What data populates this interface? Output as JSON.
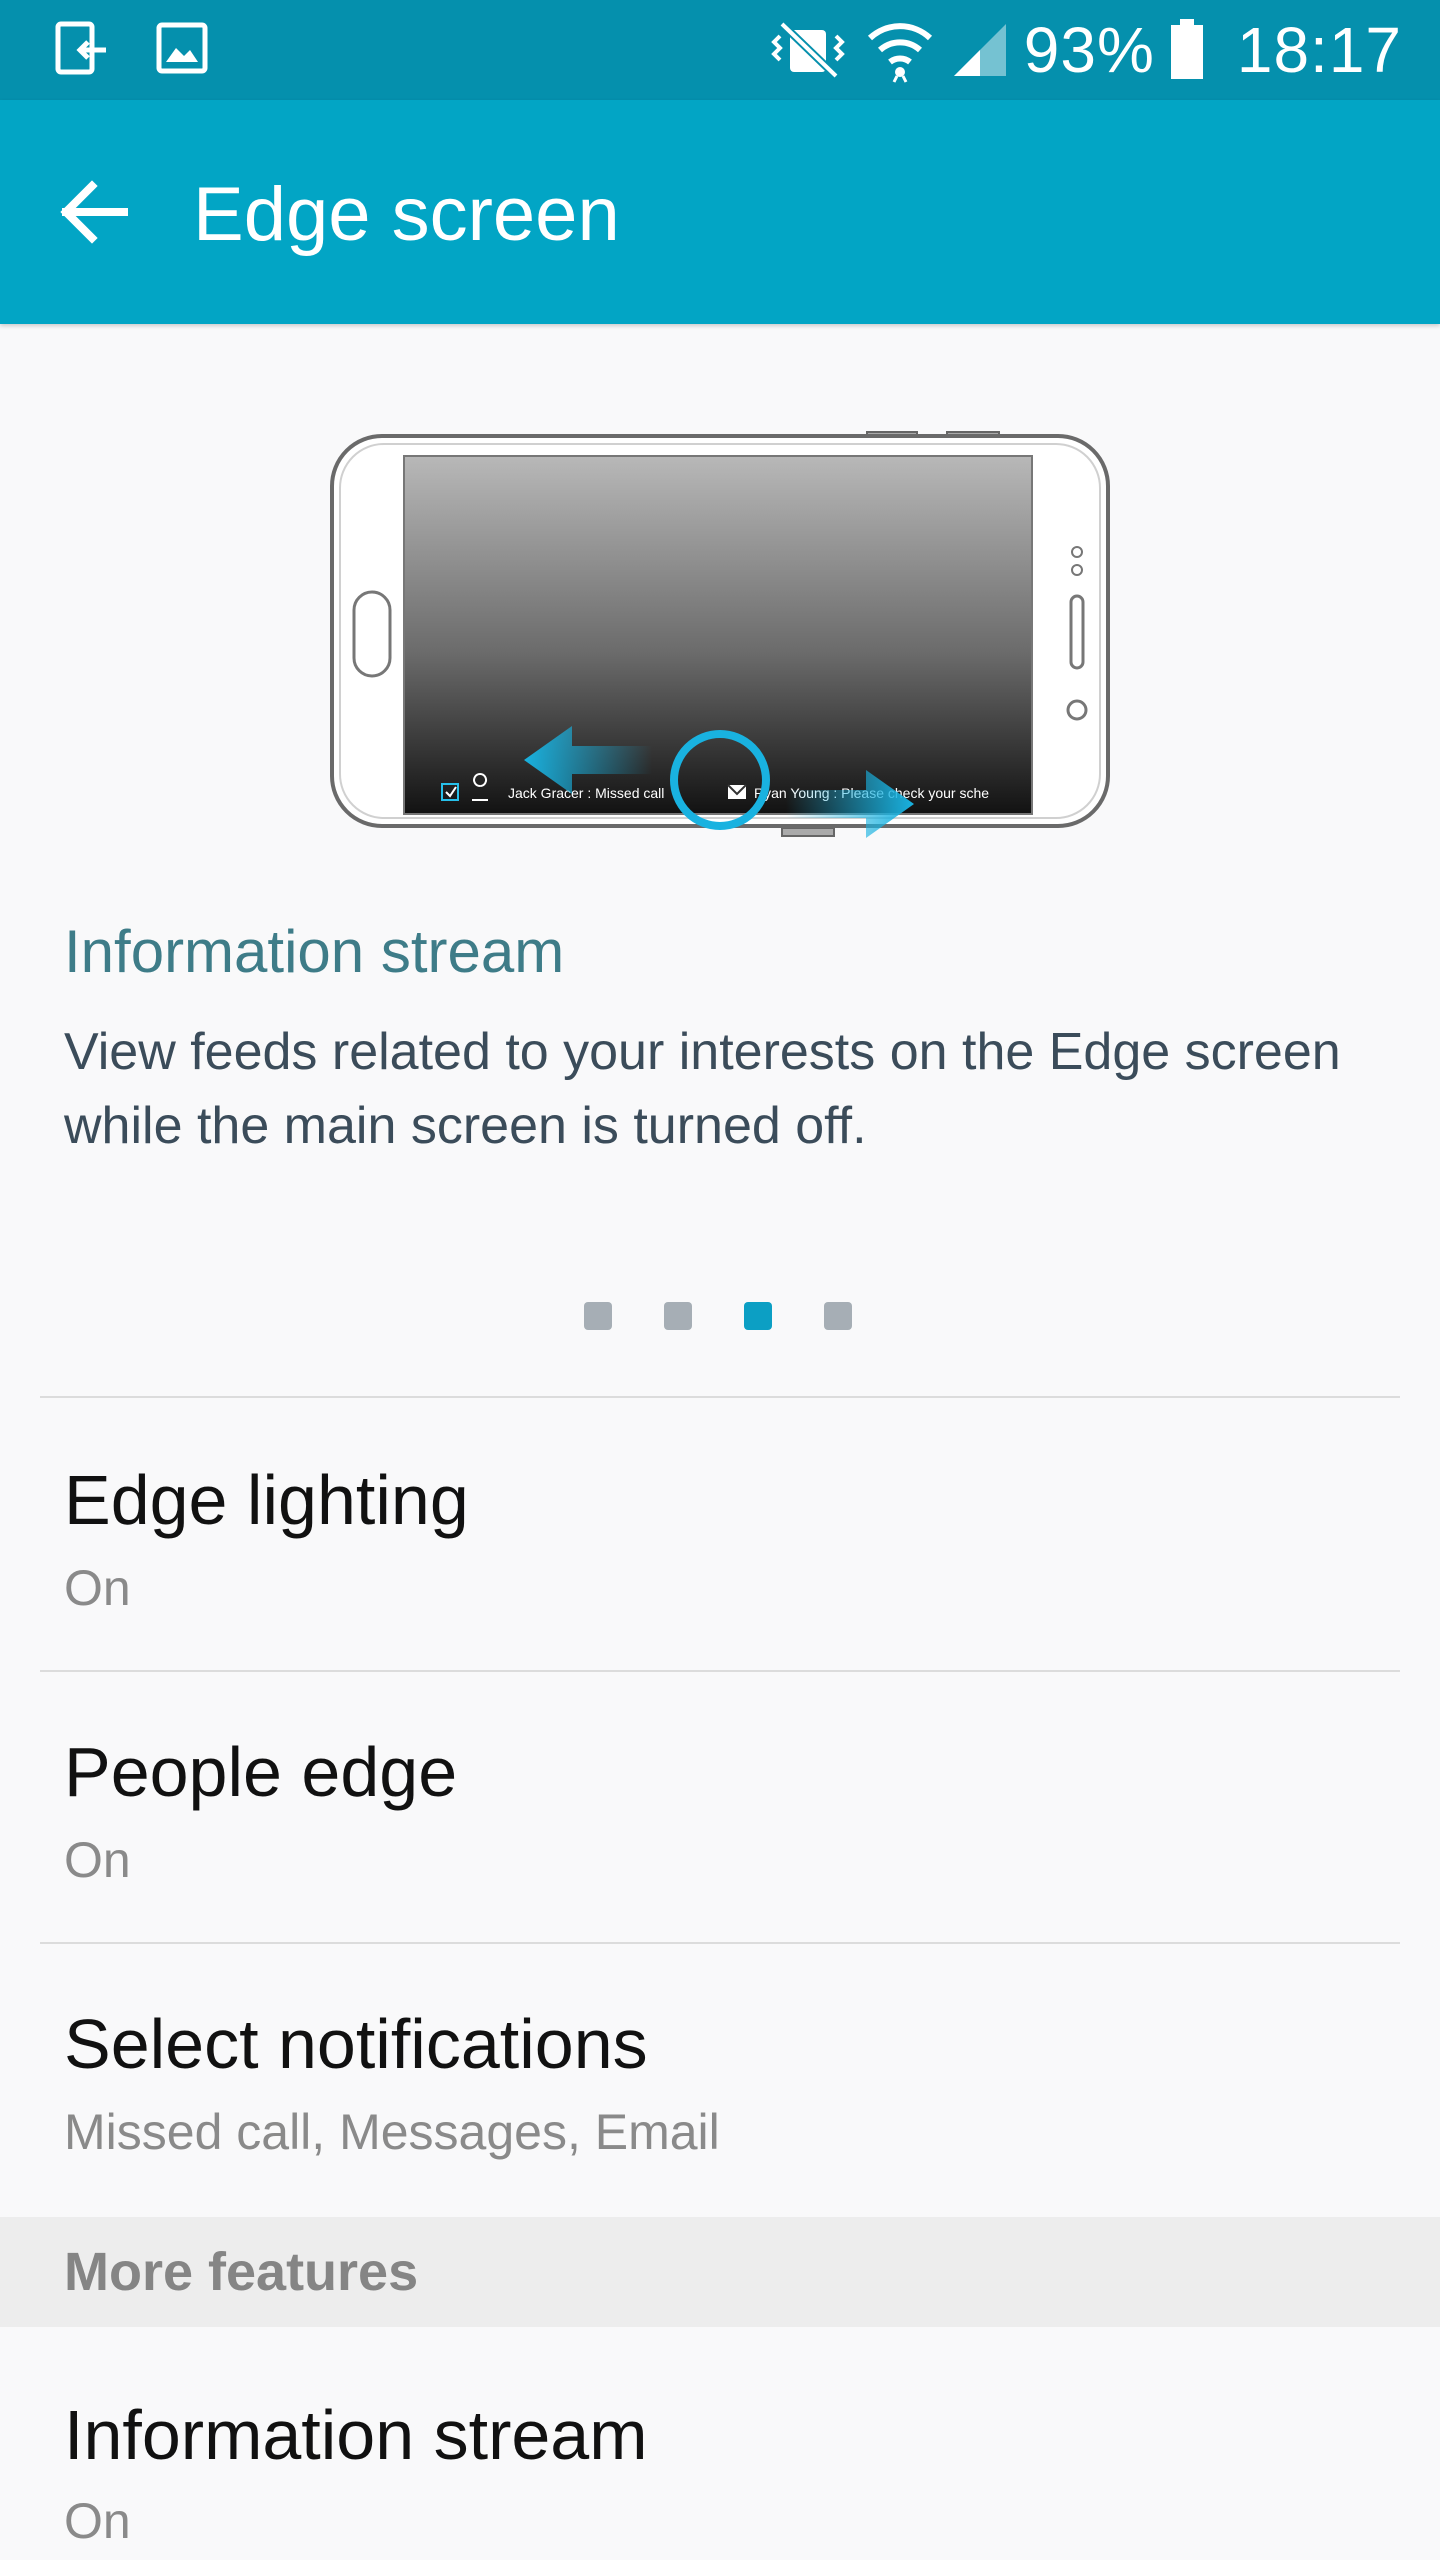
{
  "status_bar": {
    "battery_percent": "93%",
    "time": "18:17",
    "battery_level": 0.93,
    "icons": [
      "screen-share-icon",
      "gallery-icon",
      "vibrate-mute-icon",
      "wifi-icon",
      "signal-icon",
      "battery-icon"
    ]
  },
  "toolbar": {
    "title": "Edge screen",
    "back_icon": "back-arrow-icon",
    "background": "#02a5c5"
  },
  "illustration": {
    "notif_1": "Jack Gracer : Missed call",
    "notif_2": "Ryan Young : Please check your sche"
  },
  "carousel": {
    "title": "Information stream",
    "description": "View feeds related to your interests on the Edge screen while the main screen is turned off.",
    "page_count": 4,
    "active_page": 3,
    "accent": "#0c9fc4"
  },
  "settings": [
    {
      "title": "Edge lighting",
      "value": "On"
    },
    {
      "title": "People edge",
      "value": "On"
    },
    {
      "title": "Select notifications",
      "value": "Missed call, Messages, Email"
    }
  ],
  "more_features": {
    "header": "More features",
    "items": [
      {
        "title": "Information stream",
        "value": "On"
      }
    ]
  }
}
